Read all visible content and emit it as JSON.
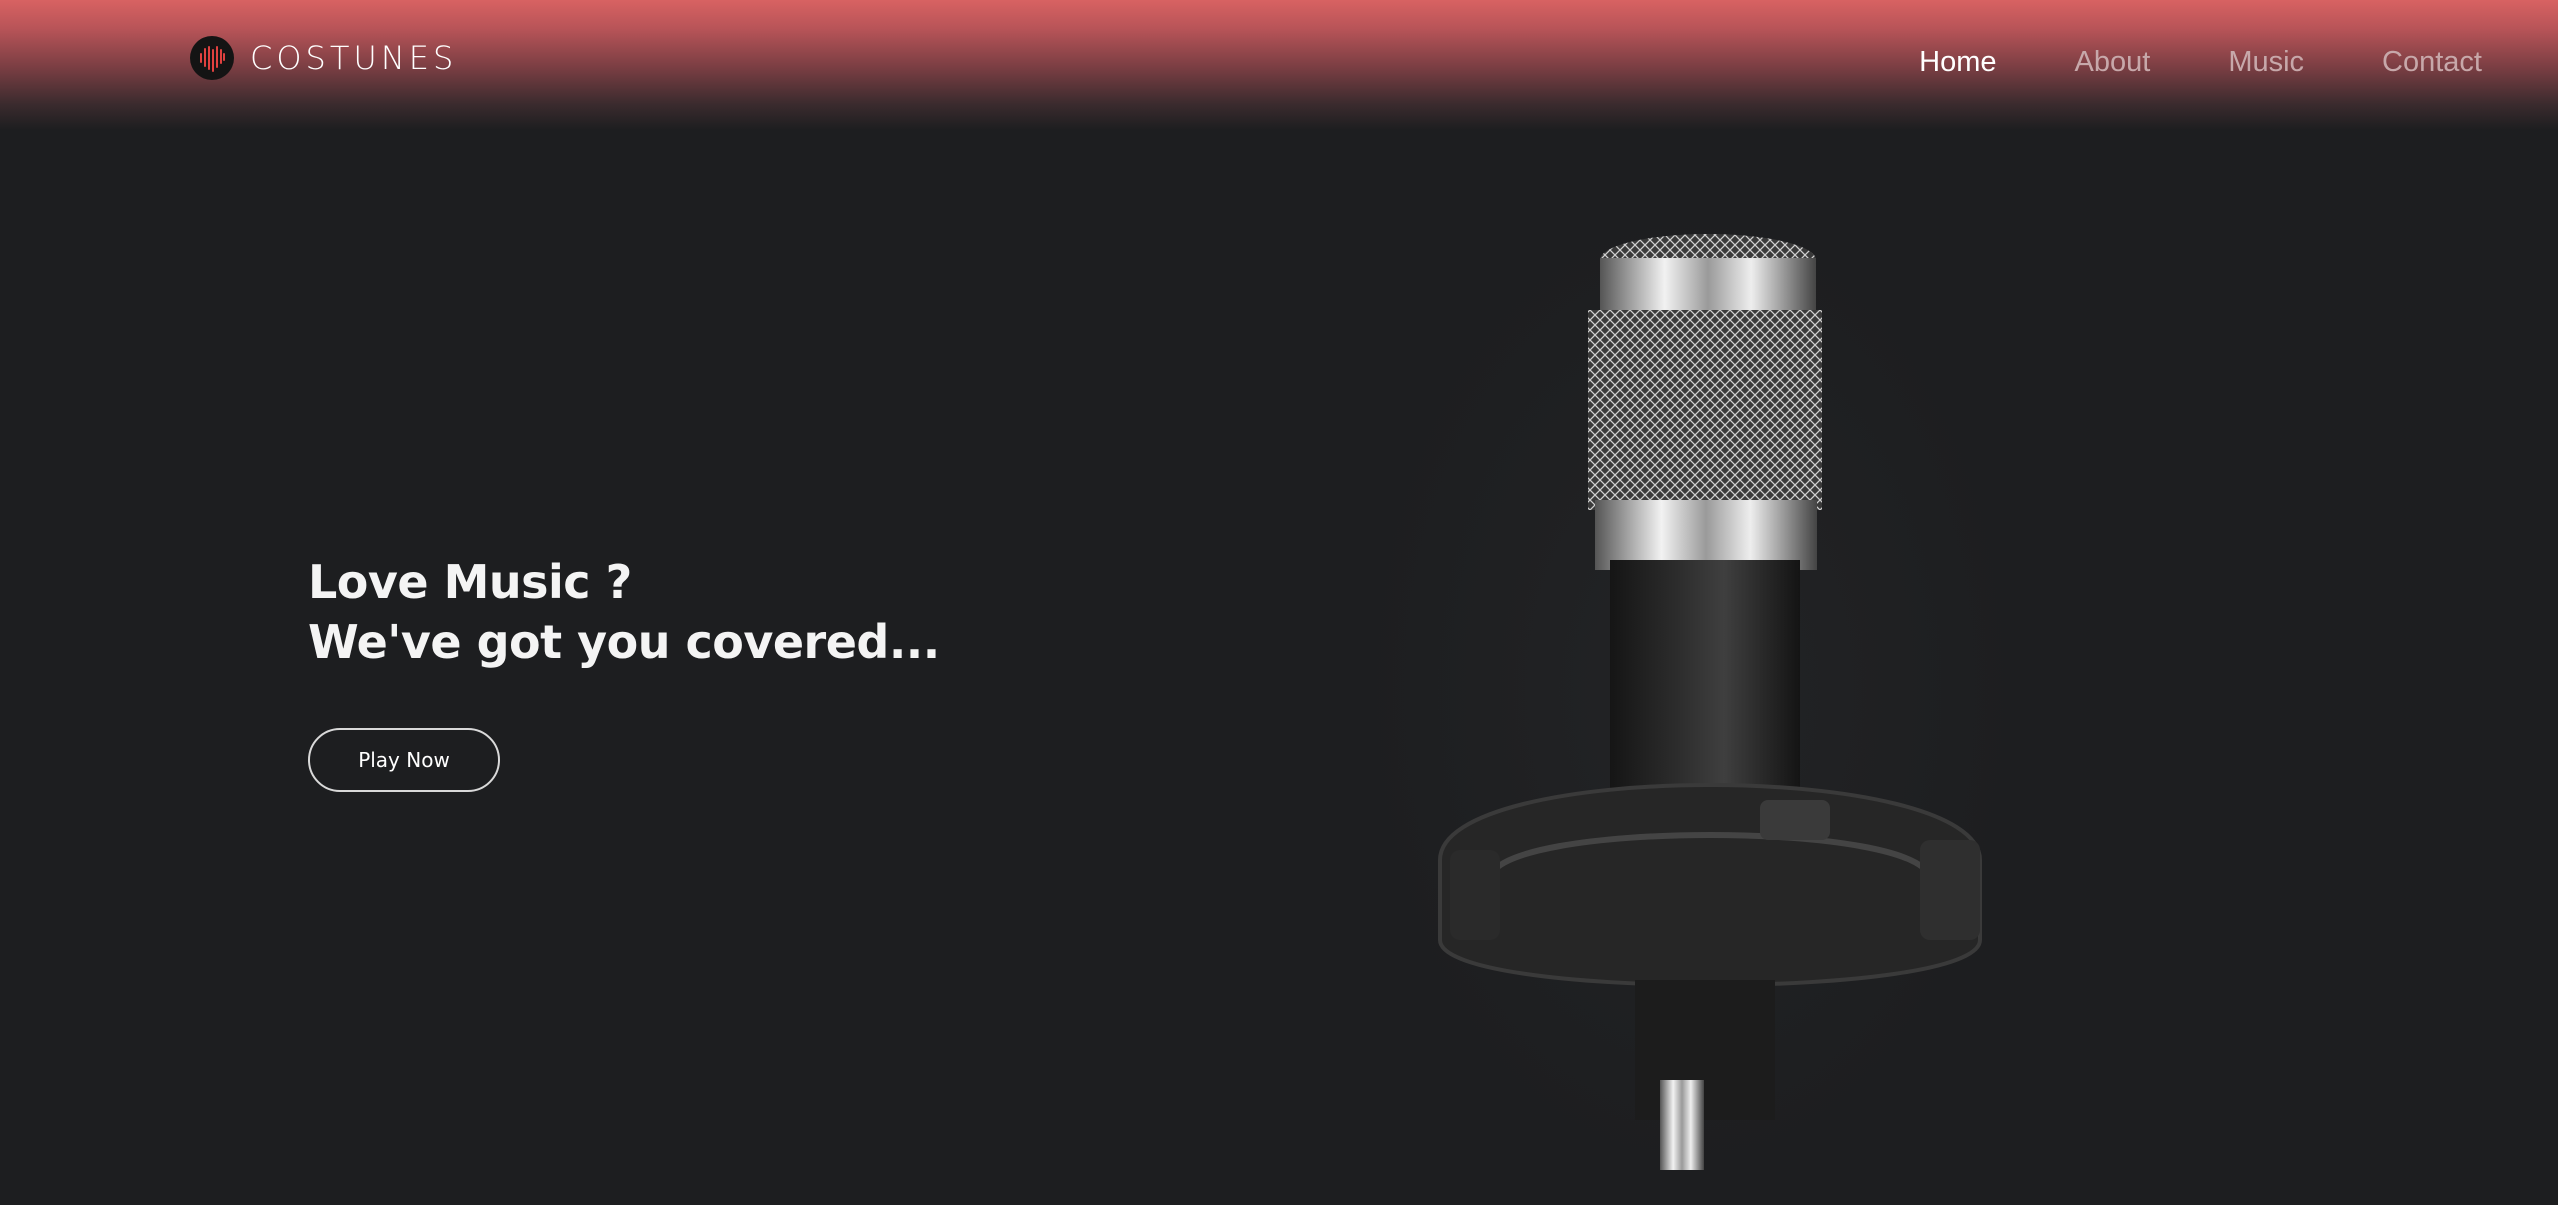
{
  "brand": {
    "name": "COSTUNES",
    "logo_icon": "soundwave-heart-icon",
    "accent_color": "#d86262"
  },
  "nav": {
    "items": [
      {
        "label": "Home",
        "active": true
      },
      {
        "label": "About",
        "active": false
      },
      {
        "label": "Music",
        "active": false
      },
      {
        "label": "Contact",
        "active": false
      }
    ]
  },
  "hero": {
    "line1": "Love Music ?",
    "line2": "We've got you covered...",
    "cta_label": "Play Now",
    "image_icon": "microphone-icon"
  },
  "colors": {
    "background": "#1d1e20",
    "header_gradient_top": "#d86262"
  }
}
